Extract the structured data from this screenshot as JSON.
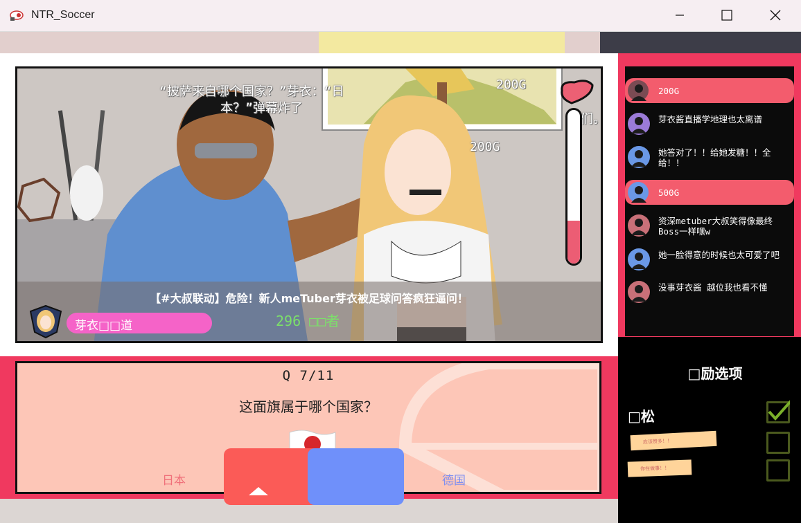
{
  "window": {
    "title": "NTR_Soccer"
  },
  "stream": {
    "danmaku": [
      "“披萨来自哪个国家？”芽衣：“日",
      "本？”弹幕炸了",
      "200G",
      "200G",
      "们。"
    ],
    "subtitle": "【#大叔联动】危险！新人meTuber芽衣被足球问答疯狂逼问！",
    "host_name": "芽衣□□道",
    "viewers": "296 □□者",
    "meter_level": 0.28
  },
  "quiz": {
    "number": "Q 7/11",
    "question": "这面旗属于哪个国家？",
    "answer_left": "日本",
    "answer_right": "德国"
  },
  "chat": {
    "messages": [
      {
        "text": "200G",
        "gift": true,
        "avatar_color": "#7a4b53"
      },
      {
        "text": "芽衣酱直播学地理也太离谱",
        "gift": false,
        "avatar_color": "#9b7bd8"
      },
      {
        "text": "她答对了！！给她发糖！！全给！！",
        "gift": false,
        "avatar_color": "#6a98e6"
      },
      {
        "text": "500G",
        "gift": true,
        "avatar_color": "#6a98e6"
      },
      {
        "text": "资深metuber大叔笑得像最终Boss一样嘿w",
        "gift": false,
        "avatar_color": "#c97078"
      },
      {
        "text": "她一脸得意的时候也太可爱了吧",
        "gift": false,
        "avatar_color": "#6a98e6"
      },
      {
        "text": "没事芽衣酱 越位我也看不懂",
        "gift": false,
        "avatar_color": "#c97078"
      }
    ]
  },
  "options": {
    "title": "□励选项",
    "relax_label": "□松",
    "tapes": [
      "应该赞多！！",
      "你在做事！！"
    ]
  },
  "colors": {
    "accent": "#f0395f",
    "gift": "#f35c6d",
    "red_button": "#fb5b57",
    "blue_button": "#6f90fa"
  }
}
